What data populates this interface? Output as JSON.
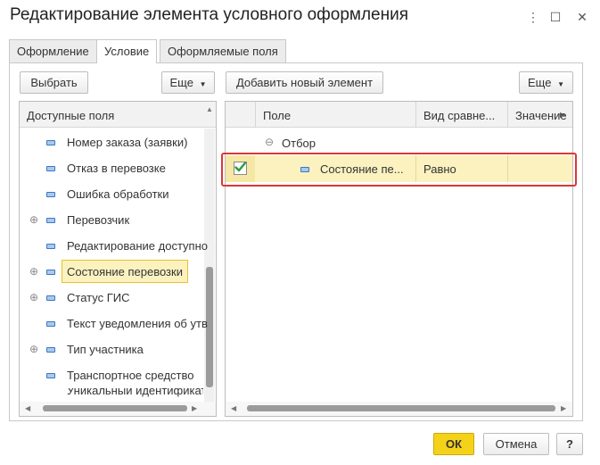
{
  "window": {
    "title": "Редактирование элемента условного оформления",
    "more_icon": "⋮",
    "maximize_icon": "☐",
    "close_icon": "✕"
  },
  "tabs": [
    {
      "label": "Оформление"
    },
    {
      "label": "Условие"
    },
    {
      "label": "Оформляемые поля"
    }
  ],
  "left": {
    "select_label": "Выбрать",
    "more_label": "Еще",
    "header": "Доступные поля",
    "fields": [
      {
        "label": "Номер заказа (заявки)",
        "expandable": false
      },
      {
        "label": "Отказ в перевозке",
        "expandable": false
      },
      {
        "label": "Ошибка обработки",
        "expandable": false
      },
      {
        "label": "Перевозчик",
        "expandable": true
      },
      {
        "label": "Редактирование доступно",
        "expandable": false
      },
      {
        "label": "Состояние перевозки",
        "expandable": true,
        "selected": true
      },
      {
        "label": "Статус ГИС",
        "expandable": true
      },
      {
        "label": "Текст уведомления об утв",
        "expandable": false
      },
      {
        "label": "Тип участника",
        "expandable": true
      },
      {
        "label": "Транспортное средство",
        "expandable": false
      },
      {
        "label": "Уникальный идентификатор",
        "expandable": false
      }
    ]
  },
  "right": {
    "add_label": "Добавить новый элемент",
    "more_label": "Еще",
    "columns": [
      "Поле",
      "Вид сравне...",
      "Значение"
    ],
    "group": "Отбор",
    "rows": [
      {
        "checked": true,
        "field": "Состояние пе...",
        "comparison": "Равно",
        "value": ""
      }
    ]
  },
  "footer": {
    "ok_label": "ОК",
    "cancel_label": "Отмена",
    "help_label": "?"
  },
  "colors": {
    "accent_yellow": "#f5d21a",
    "selection": "#fbf2c0",
    "highlight_border": "#d9383a",
    "check_green": "#2e9b3a"
  }
}
